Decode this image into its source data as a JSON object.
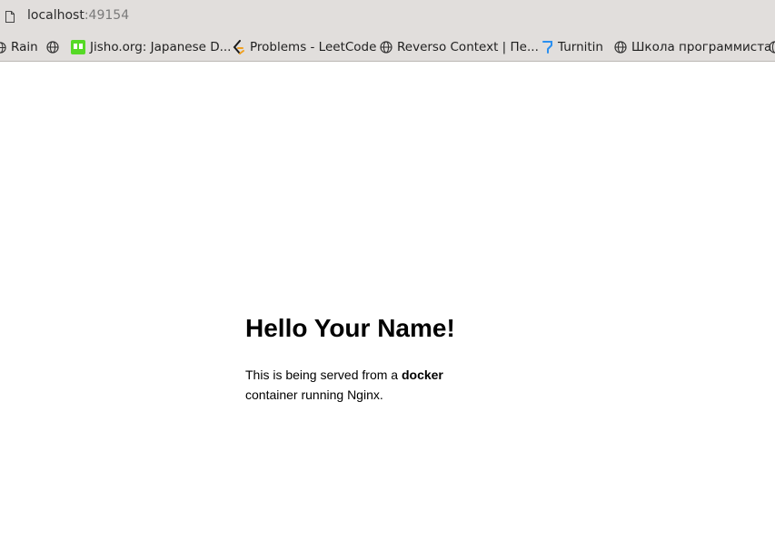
{
  "address_bar": {
    "host": "localhost",
    "port": ":49154",
    "icon": "page-icon"
  },
  "bookmarks": [
    {
      "label": "Rain",
      "icon": "globe-icon"
    },
    {
      "label": "",
      "icon": "globe-icon"
    },
    {
      "label": "Jisho.org: Japanese D...",
      "icon": "jisho-icon"
    },
    {
      "label": "Problems - LeetCode",
      "icon": "leetcode-icon"
    },
    {
      "label": "Reverso Context | Пе...",
      "icon": "globe-icon"
    },
    {
      "label": "Turnitin",
      "icon": "turnitin-icon"
    },
    {
      "label": "Школа программиста",
      "icon": "globe-icon"
    }
  ],
  "page": {
    "heading": "Hello Your Name!",
    "text_before": "This is being served from a ",
    "text_bold": "docker",
    "text_after": " container running Nginx."
  },
  "colors": {
    "chrome_bg": "#e1dedc",
    "jisho_green": "#56d926",
    "leetcode_orange": "#f0a020",
    "turnitin_blue": "#2a8ff0"
  }
}
